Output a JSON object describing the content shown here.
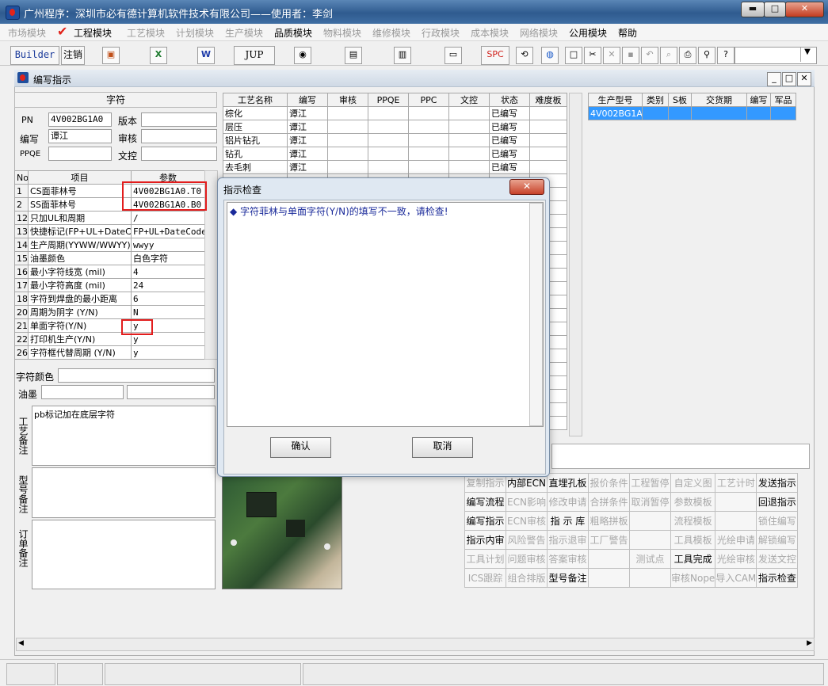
{
  "window": {
    "title": "广州程序：深圳市必有德计算机软件技术有限公司——使用者：李剑",
    "min": "▬",
    "max": "□",
    "close": "✕"
  },
  "menu": [
    {
      "label": "市场模块",
      "active": false
    },
    {
      "label": "工程模块",
      "active": true
    },
    {
      "label": "工艺模块",
      "active": false
    },
    {
      "label": "计划模块",
      "active": false
    },
    {
      "label": "生产模块",
      "active": false
    },
    {
      "label": "品质模块",
      "active": true
    },
    {
      "label": "物料模块",
      "active": false
    },
    {
      "label": "维修模块",
      "active": false
    },
    {
      "label": "行政模块",
      "active": false
    },
    {
      "label": "成本模块",
      "active": false
    },
    {
      "label": "网络模块",
      "active": false
    },
    {
      "label": "公用模块",
      "active": true
    },
    {
      "label": "帮助",
      "active": true
    }
  ],
  "menu_check": "✔",
  "toolbar": {
    "builder": "Builder",
    "logout": "注销",
    "excel": "X",
    "word": "W",
    "jup": "JUP",
    "spc": "SPC"
  },
  "mdi": {
    "title": "编写指示",
    "min": "_",
    "max": "□",
    "close": "✕"
  },
  "left": {
    "header": "字符",
    "pn_label": "PN",
    "pn_value": "4V002BG1A0",
    "version_label": "版本",
    "version_value": "",
    "writer_label": "编写",
    "writer_value": "谭江",
    "audit_label": "审核",
    "audit_value": "",
    "ppqe_label": "PPQE",
    "ppqe_value": "",
    "wenkong_label": "文控",
    "wenkong_value": "",
    "grid_headers": [
      "No",
      "项目",
      "参数"
    ],
    "rows": [
      {
        "no": "1",
        "item": "CS面菲林号",
        "param": "4V002BG1A0.T0"
      },
      {
        "no": "2",
        "item": "SS面菲林号",
        "param": "4V002BG1A0.B0"
      },
      {
        "no": "12",
        "item": "只加UL和周期",
        "param": "/"
      },
      {
        "no": "13",
        "item": "快捷标记(FP+UL+DateCo",
        "param": "FP+UL+DateCode"
      },
      {
        "no": "14",
        "item": "生产周期(YYWW/WWYY)",
        "param": "wwyy"
      },
      {
        "no": "15",
        "item": "油墨颜色",
        "param": "白色字符"
      },
      {
        "no": "16",
        "item": "最小字符线宽 (mil)",
        "param": "4"
      },
      {
        "no": "17",
        "item": "最小字符高度 (mil)",
        "param": "24"
      },
      {
        "no": "18",
        "item": "字符到焊盘的最小距离",
        "param": "6"
      },
      {
        "no": "20",
        "item": "周期为阴字 (Y/N)",
        "param": "N"
      },
      {
        "no": "21",
        "item": "单面字符(Y/N)",
        "param": "y"
      },
      {
        "no": "22",
        "item": "打印机生产(Y/N)",
        "param": "y"
      },
      {
        "no": "26",
        "item": "字符框代替周期 (Y/N)",
        "param": "y"
      }
    ],
    "color_label": "字符颜色",
    "ink_label": "油墨",
    "note1_label": "工艺备注",
    "note1_text": "pb标记加在底层字符",
    "note2_label": "型号备注",
    "note3_label": "订单备注"
  },
  "process": {
    "headers": [
      "工艺名称",
      "编写",
      "审核",
      "PPQE",
      "PPC",
      "文控",
      "状态",
      "难度板"
    ],
    "rows": [
      {
        "name": "棕化",
        "writer": "谭江",
        "status": "已编写"
      },
      {
        "name": "层压",
        "writer": "谭江",
        "status": "已编写"
      },
      {
        "name": "铝片钻孔",
        "writer": "谭江",
        "status": "已编写"
      },
      {
        "name": "钻孔",
        "writer": "谭江",
        "status": "已编写"
      },
      {
        "name": "去毛刺",
        "writer": "谭江",
        "status": "已编写"
      }
    ]
  },
  "model": {
    "headers": [
      "生产型号",
      "类别",
      "S板",
      "交货期",
      "编写",
      "军品"
    ],
    "rows": [
      {
        "model": "4V002BG1A0"
      }
    ]
  },
  "dialog": {
    "title": "指示检查",
    "close": "✕",
    "message": "◆ 字符菲林与单面字符(Y/N)的填写不一致，请检查!",
    "ok": "确认",
    "cancel": "取消"
  },
  "actions": [
    [
      {
        "t": "复制指示",
        "on": false
      },
      {
        "t": "内部ECN",
        "on": true
      },
      {
        "t": "直埋孔板",
        "on": true
      },
      {
        "t": "报价条件",
        "on": false
      },
      {
        "t": "工程暂停",
        "on": false
      },
      {
        "t": "自定义图",
        "on": false
      },
      {
        "t": "工艺计时",
        "on": false
      },
      {
        "t": "发送指示",
        "on": true
      }
    ],
    [
      {
        "t": "编写流程",
        "on": true
      },
      {
        "t": "ECN影响",
        "on": false
      },
      {
        "t": "修改申请",
        "on": false
      },
      {
        "t": "合拼条件",
        "on": false
      },
      {
        "t": "取消暂停",
        "on": false
      },
      {
        "t": "参数模板",
        "on": false
      },
      {
        "t": "",
        "on": false
      },
      {
        "t": "回退指示",
        "on": true
      }
    ],
    [
      {
        "t": "编写指示",
        "on": true
      },
      {
        "t": "ECN审核",
        "on": false
      },
      {
        "t": "指 示 库",
        "on": true
      },
      {
        "t": "粗略拼板",
        "on": false
      },
      {
        "t": "",
        "on": false
      },
      {
        "t": "流程模板",
        "on": false
      },
      {
        "t": "",
        "on": false
      },
      {
        "t": "锁住编写",
        "on": false
      }
    ],
    [
      {
        "t": "指示内审",
        "on": true
      },
      {
        "t": "风险警告",
        "on": false
      },
      {
        "t": "指示退审",
        "on": false
      },
      {
        "t": "工厂警告",
        "on": false
      },
      {
        "t": "",
        "on": false
      },
      {
        "t": "工具模板",
        "on": false
      },
      {
        "t": "光绘申请",
        "on": false
      },
      {
        "t": "解锁编写",
        "on": false
      }
    ],
    [
      {
        "t": "工具计划",
        "on": false
      },
      {
        "t": "问题审核",
        "on": false
      },
      {
        "t": "答案审核",
        "on": false
      },
      {
        "t": "",
        "on": false
      },
      {
        "t": "测试点",
        "on": false
      },
      {
        "t": "工具完成",
        "on": true
      },
      {
        "t": "光绘审核",
        "on": false
      },
      {
        "t": "发送文控",
        "on": false
      }
    ],
    [
      {
        "t": "ICS跟踪",
        "on": false
      },
      {
        "t": "组合排版",
        "on": false
      },
      {
        "t": "型号备注",
        "on": true
      },
      {
        "t": "",
        "on": false
      },
      {
        "t": "",
        "on": false
      },
      {
        "t": "审核Nope",
        "on": false
      },
      {
        "t": "导入CAM",
        "on": false
      },
      {
        "t": "指示检查",
        "on": true
      }
    ]
  ]
}
